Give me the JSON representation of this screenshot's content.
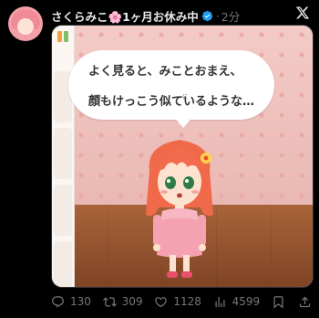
{
  "post": {
    "display_name": "さくらみこ🌸1ヶ月お休み中",
    "separator": "·",
    "time": "2分"
  },
  "media": {
    "line1_before": "よく",
    "line1_kanji": "見",
    "line1_after": "ると、みことおまえ、",
    "line2_kanji1": "顔",
    "line2_mid": "もけっこう",
    "line2_kanji2": "似",
    "line2_after": "ているような…",
    "ruby_mi": "み",
    "ruby_kao": "かお",
    "ruby_ni": "に"
  },
  "actions": {
    "replies": "130",
    "reposts": "309",
    "likes": "1128",
    "views": "4599"
  },
  "colors": {
    "verified": "#1d9bf0",
    "muted": "#71767b"
  }
}
